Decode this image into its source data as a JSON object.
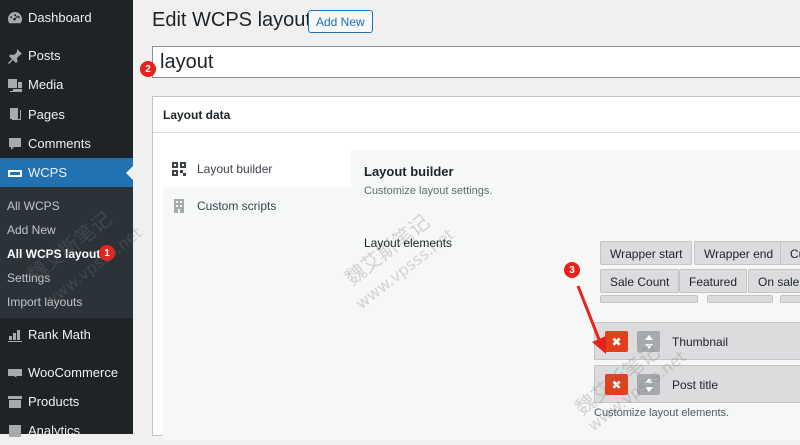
{
  "sidebar": {
    "items": [
      {
        "label": "Dashboard",
        "icon": "dashboard-icon"
      },
      {
        "label": "Posts",
        "icon": "pin-icon"
      },
      {
        "label": "Media",
        "icon": "media-icon"
      },
      {
        "label": "Pages",
        "icon": "pages-icon"
      },
      {
        "label": "Comments",
        "icon": "comments-icon"
      },
      {
        "label": "WCPS",
        "icon": "slider-icon",
        "active": true
      },
      {
        "label": "Rank Math",
        "icon": "chart-icon"
      },
      {
        "label": "WooCommerce",
        "icon": "woo-icon"
      },
      {
        "label": "Products",
        "icon": "archive-icon"
      },
      {
        "label": "Analytics",
        "icon": "analytics-icon"
      }
    ],
    "submenu": [
      {
        "label": "All WCPS"
      },
      {
        "label": "Add New"
      },
      {
        "label": "All WCPS layouts",
        "current": true
      },
      {
        "label": "Settings"
      },
      {
        "label": "Import layouts"
      }
    ],
    "colors": {
      "background": "#1d2327",
      "active": "#2271b1",
      "submenu_bg": "#2c3338"
    }
  },
  "header": {
    "title": "Edit WCPS layout",
    "add_new_label": "Add New"
  },
  "title_field": {
    "value": "layout"
  },
  "metabox": {
    "title": "Layout data",
    "tabs": [
      {
        "label": "Layout builder",
        "icon": "grid-icon",
        "active": true
      },
      {
        "label": "Custom scripts",
        "icon": "building-icon"
      }
    ],
    "panel": {
      "title": "Layout builder",
      "description": "Customize layout settings.",
      "elements_label": "Layout elements",
      "available_elements": [
        "Wrapper start",
        "Wrapper end",
        "Cu",
        "Sale Count",
        "Featured",
        "On sale"
      ],
      "selected_elements": [
        "Thumbnail",
        "Post title"
      ],
      "customize_description": "Customize layout elements.",
      "remove_symbol": "✖"
    }
  },
  "annotations": {
    "badges": [
      "1",
      "2",
      "3"
    ],
    "watermarks": [
      "魏艾斯笔记",
      "www.vpsss.net",
      "魏艾斯笔记",
      "www.vpsss.net",
      "魏艾斯笔记",
      "www.vpsss.net"
    ]
  }
}
